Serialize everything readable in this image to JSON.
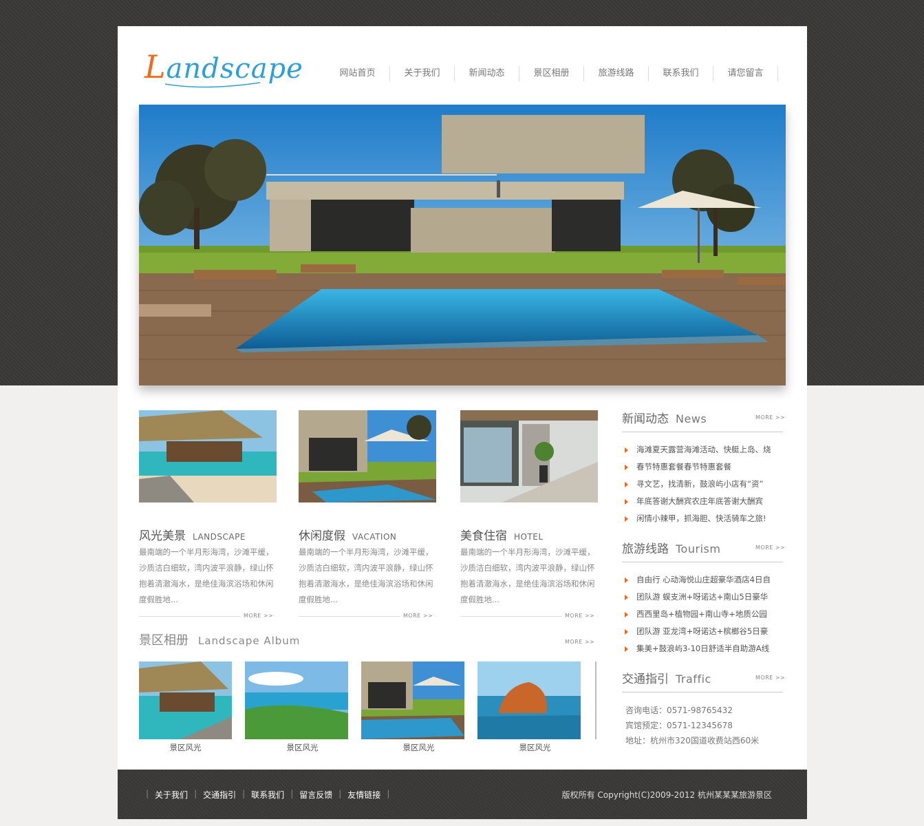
{
  "site": {
    "logo_main": "Landscape",
    "logo_initial": "L",
    "logo_rest": "andscape"
  },
  "nav": [
    "网站首页",
    "关于我们",
    "新闻动态",
    "景区相册",
    "旅游线路",
    "联系我们",
    "请您留言"
  ],
  "hero": {
    "alt": "villa pool"
  },
  "features": [
    {
      "title": "风光美景",
      "en": "LANDSCAPE",
      "desc": "最南端的一个半月形海湾，沙滩平缓，沙质洁白细软，湾内波平浪静，绿山怀抱着清澈海水，是绝佳海滨浴场和休闲度假胜地...",
      "more": "MORE >>"
    },
    {
      "title": "休闲度假",
      "en": "VACATION",
      "desc": "最南端的一个半月形海湾，沙滩平缓，沙质洁白细软，湾内波平浪静，绿山怀抱着清澈海水，是绝佳海滨浴场和休闲度假胜地...",
      "more": "MORE >>"
    },
    {
      "title": "美食住宿",
      "en": "HOTEL",
      "desc": "最南端的一个半月形海湾，沙滩平缓，沙质洁白细软，湾内波平浪静，绿山怀抱着清澈海水，是绝佳海滨浴场和休闲度假胜地...",
      "more": "MORE >>"
    }
  ],
  "album": {
    "title": "景区相册",
    "en": "Landscape  Album",
    "more": "MORE >>",
    "items": [
      "景区风光",
      "景区风光",
      "景区风光",
      "景区风光"
    ]
  },
  "news": {
    "title": "新闻动态",
    "en": "News",
    "more": "MORE >>",
    "items": [
      "海滩夏天露营海滩活动、快艇上岛、烧",
      "春节特惠套餐春节特惠套餐",
      "寻文艺，找清新，鼓浪屿小店有“资”",
      "年底答谢大酬宾农庄年底答谢大酬宾",
      "闲情小辣甲，抓海胆、快活骑车之旅!"
    ]
  },
  "tourism": {
    "title": "旅游线路",
    "en": "Tourism",
    "more": "MORE >>",
    "items": [
      "自由行 心动海悦山庄超豪华酒店4日自",
      "团队游 蜈支洲+呀诺达+南山5日豪华",
      "西西里岛+植物园+南山寺+地质公园",
      "团队游 亚龙湾+呀诺达+槟榔谷5日豪",
      "集美+鼓浪屿3-10日舒适半自助游A线"
    ]
  },
  "traffic": {
    "title": "交通指引",
    "en": "Traffic",
    "more": "MORE >>",
    "phone": "咨询电话：0571-98765432",
    "hotel": "宾馆预定：0571-12345678",
    "address": "地址：杭州市320国道收费站西60米"
  },
  "footer": {
    "links": [
      "关于我们",
      "交通指引",
      "联系我们",
      "留言反馈",
      "友情链接"
    ],
    "copyright": "版权所有 Copyright(C)2009-2012 杭州某某某旅游景区"
  },
  "colors": {
    "accent": "#e86a1c",
    "logo_blue": "#2d9fd8",
    "dark_bg": "#3a3938"
  }
}
